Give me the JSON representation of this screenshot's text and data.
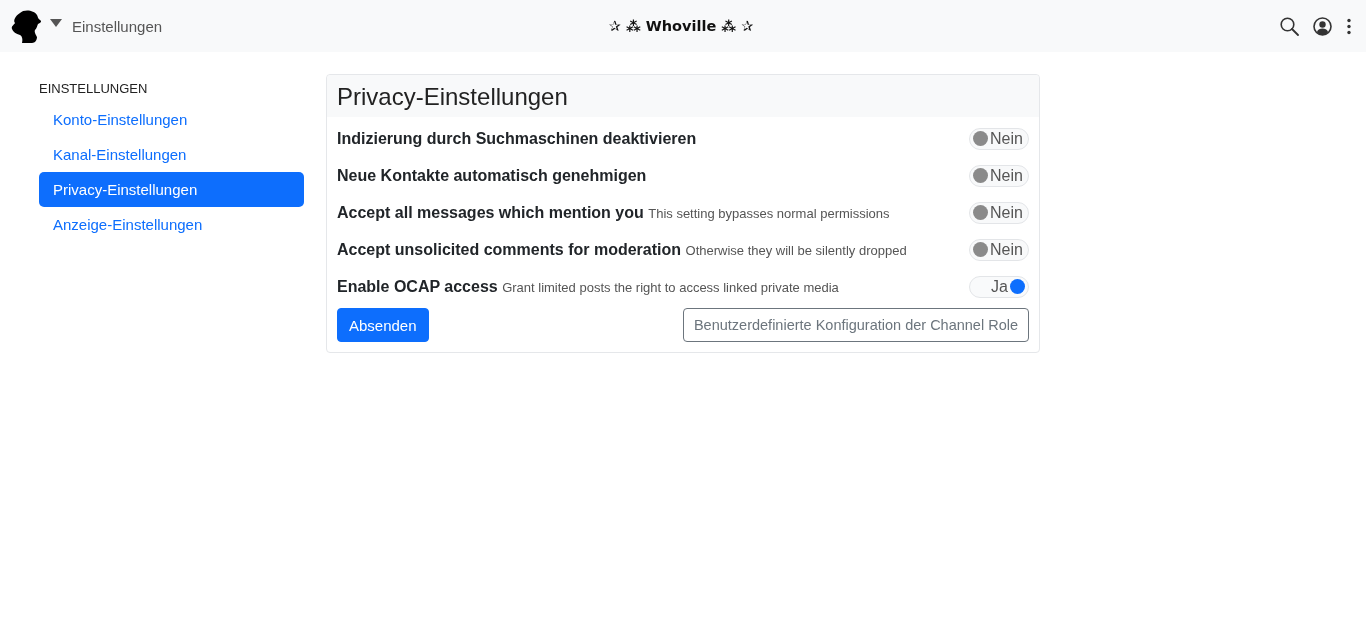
{
  "navbar": {
    "page_title": "Einstellungen",
    "site_name": "✰ ⁂ Whoville ⁂ ✰"
  },
  "sidebar": {
    "heading": "EINSTELLUNGEN",
    "items": [
      {
        "label": "Konto-Einstellungen",
        "selected": false
      },
      {
        "label": "Kanal-Einstellungen",
        "selected": false
      },
      {
        "label": "Privacy-Einstellungen",
        "selected": true
      },
      {
        "label": "Anzeige-Einstellungen",
        "selected": false
      }
    ]
  },
  "panel": {
    "title": "Privacy-Einstellungen",
    "settings": [
      {
        "label": "Indizierung durch Suchmaschinen deaktivieren",
        "on": false,
        "state_text": "Nein"
      },
      {
        "label": "Neue Kontakte automatisch genehmigen",
        "on": false,
        "state_text": "Nein"
      },
      {
        "label": "Accept all messages which mention you",
        "description": "This setting bypasses normal permissions",
        "on": false,
        "state_text": "Nein"
      },
      {
        "label": "Accept unsolicited comments for moderation",
        "description": "Otherwise they will be silently dropped",
        "on": false,
        "state_text": "Nein"
      },
      {
        "label": "Enable OCAP access",
        "description": "Grant limited posts the right to access linked private media",
        "on": true,
        "state_text": "Ja"
      }
    ],
    "buttons": [
      {
        "label": "Absenden",
        "kind": "primary"
      },
      {
        "label": "Benutzerdefinierte Konfiguration der Channel Role",
        "kind": "outline"
      }
    ]
  }
}
